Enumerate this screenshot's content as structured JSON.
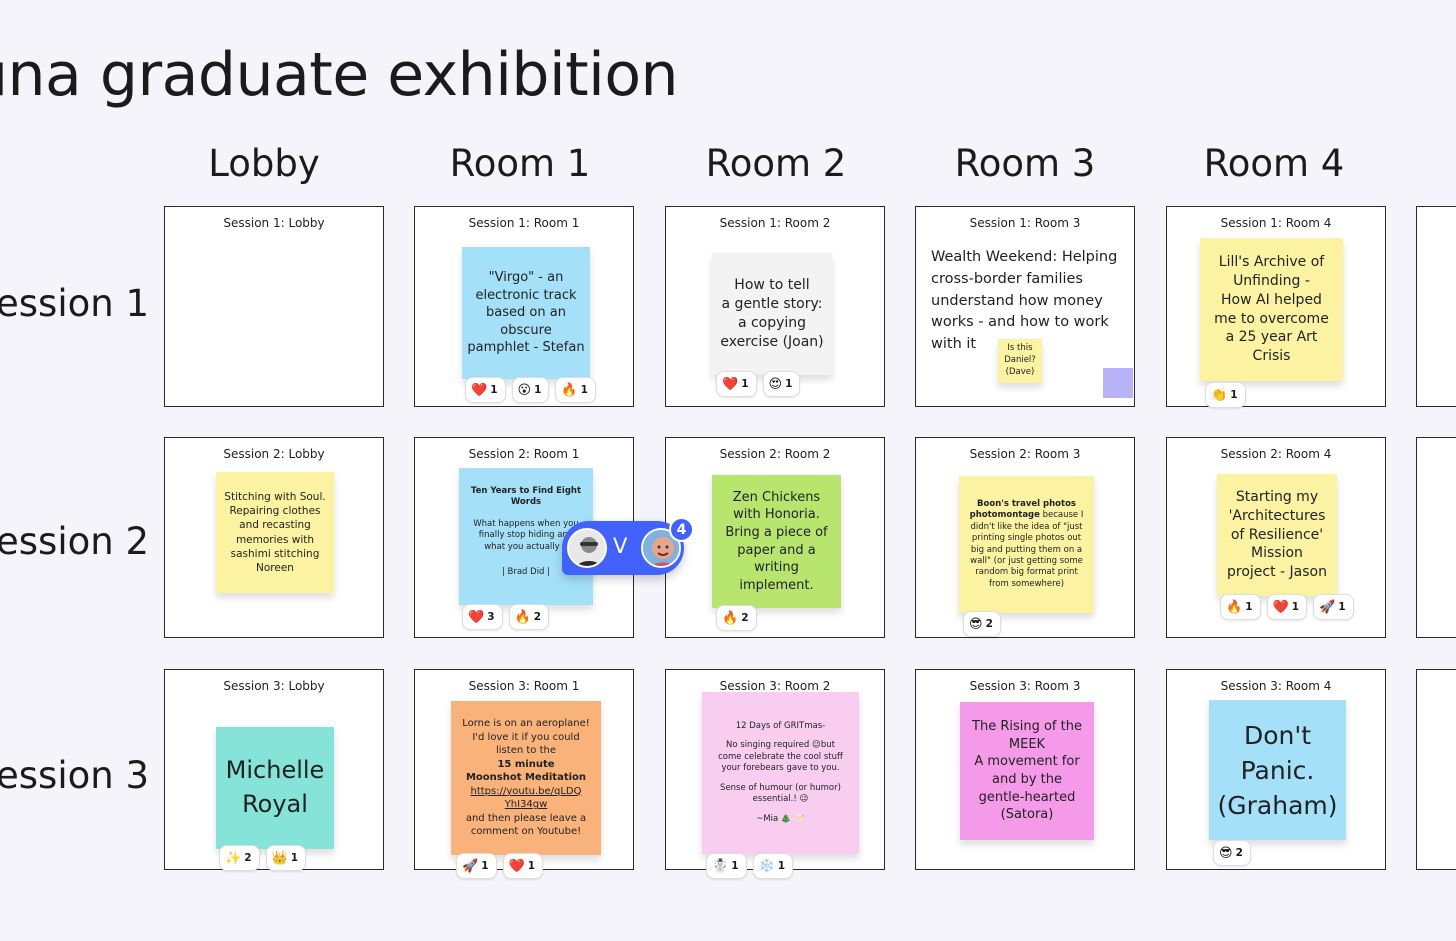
{
  "board": {
    "title": "una graduate exhibition"
  },
  "columns": [
    "Lobby",
    "Room 1",
    "Room 2",
    "Room 3",
    "Room 4"
  ],
  "rows": [
    "ession 1",
    "ession 2",
    "ession 3"
  ],
  "frames": {
    "s1_lobby": "Session 1: Lobby",
    "s1_room1": "Session 1: Room 1",
    "s1_room2": "Session 1: Room 2",
    "s1_room3": "Session 1: Room 3",
    "s1_room4": "Session 1: Room 4",
    "s2_lobby": "Session 2: Lobby",
    "s2_room1": "Session 2: Room 1",
    "s2_room2": "Session 2: Room 2",
    "s2_room3": "Session 2: Room 3",
    "s2_room4": "Session 2: Room 4",
    "s3_lobby": "Session 3: Lobby",
    "s3_room1": "Session 3: Room 1",
    "s3_room2": "Session 3: Room 2",
    "s3_room3": "Session 3: Room 3",
    "s3_room4": "Session 3: Room 4"
  },
  "notes": {
    "s1_room1": [
      "\"Virgo\" - an",
      "electronic track",
      "based on an",
      "obscure",
      "pamphlet - Stefan"
    ],
    "s1_room2": [
      "How to tell",
      "a gentle story:",
      "a copying",
      "exercise (Joan)"
    ],
    "s1_room3": [
      "Wealth Weekend: Helping",
      "cross-border families",
      "understand how money",
      "works - and how to work",
      "with it"
    ],
    "s1_room3_small": [
      "Is this",
      "Daniel?",
      "(Dave)"
    ],
    "s1_room4": [
      "Lill's Archive of",
      "Unfinding -",
      "How AI helped",
      "me to overcome",
      "a 25 year Art",
      "Crisis"
    ],
    "s2_lobby": [
      "Stitching with Soul.",
      "Repairing clothes",
      "and recasting",
      "memories with",
      "sashimi stitching",
      "Noreen"
    ],
    "s2_room1_title": [
      "Ten Years to Find Eight",
      "Words"
    ],
    "s2_room1_body": [
      "What happens when you",
      "finally stop hiding and",
      "what you actually d"
    ],
    "s2_room1_sign": "| Brad Did |",
    "s2_room2": [
      "Zen Chickens",
      "with Honoria.",
      "Bring a piece of",
      "paper and a",
      "writing",
      "implement."
    ],
    "s2_room3_bold": "Boon's travel photos photomontage",
    "s2_room3_rest": " because I didn't like the idea of \"just printing single photos out big and putting them on a wall\" (or just getting some random big format print from somewhere)",
    "s2_room4": [
      "Starting my",
      "'Architectures",
      "of Resilience'",
      "Mission",
      "project - Jason"
    ],
    "s3_lobby": [
      "Michelle",
      "Royal"
    ],
    "s3_room1_a": [
      "Lorne is on an aeroplane!",
      "I'd love it if you could",
      "listen to the"
    ],
    "s3_room1_bold": [
      "15 minute",
      "Moonshot Meditation"
    ],
    "s3_room1_link": "https://youtu.be/qLDQYhI34gw",
    "s3_room1_b": [
      "and then please leave a",
      "comment on Youtube!"
    ],
    "s3_room2": [
      "12 Days of GRITmas-",
      "",
      "No singing required 😉but",
      "come celebrate the cool stuff",
      "your forebears gave to you.",
      "",
      "Sense of humour (or humor)",
      "essential.! 😉",
      "",
      "~Mia 🎄 🥂"
    ],
    "s3_room3": [
      "The Rising of the",
      "MEEK",
      "A movement for",
      "and by the",
      "gentle-hearted",
      "(Satora)"
    ],
    "s3_room4": [
      "Don't",
      "Panic.",
      "(Graham)"
    ]
  },
  "reactions": {
    "s1_room1": [
      {
        "emoji": "❤️",
        "count": "1"
      },
      {
        "emoji": "😮",
        "count": "1"
      },
      {
        "emoji": "🔥",
        "count": "1"
      }
    ],
    "s1_room2": [
      {
        "emoji": "❤️",
        "count": "1"
      },
      {
        "emoji": "😍",
        "count": "1"
      }
    ],
    "s1_room4": [
      {
        "emoji": "👏",
        "count": "1"
      }
    ],
    "s2_room1": [
      {
        "emoji": "❤️",
        "count": "3"
      },
      {
        "emoji": "🔥",
        "count": "2"
      }
    ],
    "s2_room2": [
      {
        "emoji": "🔥",
        "count": "2"
      }
    ],
    "s2_room3": [
      {
        "emoji": "😎",
        "count": "2"
      }
    ],
    "s2_room4": [
      {
        "emoji": "🔥",
        "count": "1"
      },
      {
        "emoji": "❤️",
        "count": "1"
      },
      {
        "emoji": "🚀",
        "count": "1"
      }
    ],
    "s3_lobby": [
      {
        "emoji": "✨",
        "count": "2"
      },
      {
        "emoji": "👑",
        "count": "1"
      }
    ],
    "s3_room1": [
      {
        "emoji": "🚀",
        "count": "1"
      },
      {
        "emoji": "❤️",
        "count": "1"
      }
    ],
    "s3_room2": [
      {
        "emoji": "☃️",
        "count": "1"
      },
      {
        "emoji": "❄️",
        "count": "1"
      }
    ],
    "s3_room4": [
      {
        "emoji": "😎",
        "count": "2"
      }
    ]
  },
  "presence": {
    "letter": "V",
    "count": "4",
    "accent": "#4262ff"
  },
  "colors": {
    "yellow": "#fbf3a1",
    "blue": "#a4e1f8",
    "green": "#b7e56e",
    "teal": "#86e3d7",
    "orange": "#f9b27a",
    "pink": "#f8cdef",
    "magenta": "#f49ae8",
    "violet": "#b8b3f8"
  }
}
